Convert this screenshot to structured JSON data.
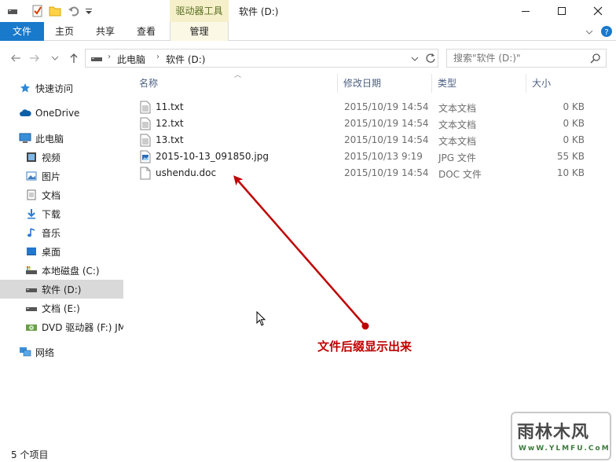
{
  "titlebar": {
    "context_tab": "驱动器工具",
    "title": "软件 (D:)"
  },
  "ribbon": {
    "file": "文件",
    "tabs": [
      "主页",
      "共享",
      "查看"
    ],
    "manage": "管理"
  },
  "address": {
    "crumbs": [
      "此电脑",
      "软件 (D:)"
    ]
  },
  "search": {
    "placeholder": "搜索\"软件 (D:)\""
  },
  "nav": {
    "quick_access": "快速访问",
    "onedrive": "OneDrive",
    "this_pc": "此电脑",
    "videos": "视频",
    "pictures": "图片",
    "documents": "文档",
    "downloads": "下载",
    "music": "音乐",
    "desktop": "桌面",
    "local_disk": "本地磁盘 (C:)",
    "software": "软件 (D:)",
    "docs_drive": "文档 (E:)",
    "dvd": "DVD 驱动器 (F:) JM",
    "network": "网络"
  },
  "columns": {
    "name": "名称",
    "modified": "修改日期",
    "type": "类型",
    "size": "大小"
  },
  "files": [
    {
      "name": "11.txt",
      "date": "2015/10/19 14:54",
      "type": "文本文档",
      "size": "0 KB",
      "icon": "text-file-icon"
    },
    {
      "name": "12.txt",
      "date": "2015/10/19 14:54",
      "type": "文本文档",
      "size": "0 KB",
      "icon": "text-file-icon"
    },
    {
      "name": "13.txt",
      "date": "2015/10/19 14:54",
      "type": "文本文档",
      "size": "0 KB",
      "icon": "text-file-icon"
    },
    {
      "name": "2015-10-13_091850.jpg",
      "date": "2015/10/13 9:19",
      "type": "JPG 文件",
      "size": "55 KB",
      "icon": "image-file-icon"
    },
    {
      "name": "ushendu.doc",
      "date": "2015/10/19 14:54",
      "type": "DOC 文件",
      "size": "10 KB",
      "icon": "doc-file-icon"
    }
  ],
  "status": {
    "count": "5 个项目"
  },
  "annotation": {
    "text": "文件后缀显示出来",
    "color": "#c00000"
  },
  "watermark": {
    "main": "雨林木风",
    "url": "WwW.YLMFU.CoM"
  },
  "colors": {
    "accent": "#1979ca",
    "context_tab": "#f5f0c9",
    "selected": "#d9d9d9"
  }
}
